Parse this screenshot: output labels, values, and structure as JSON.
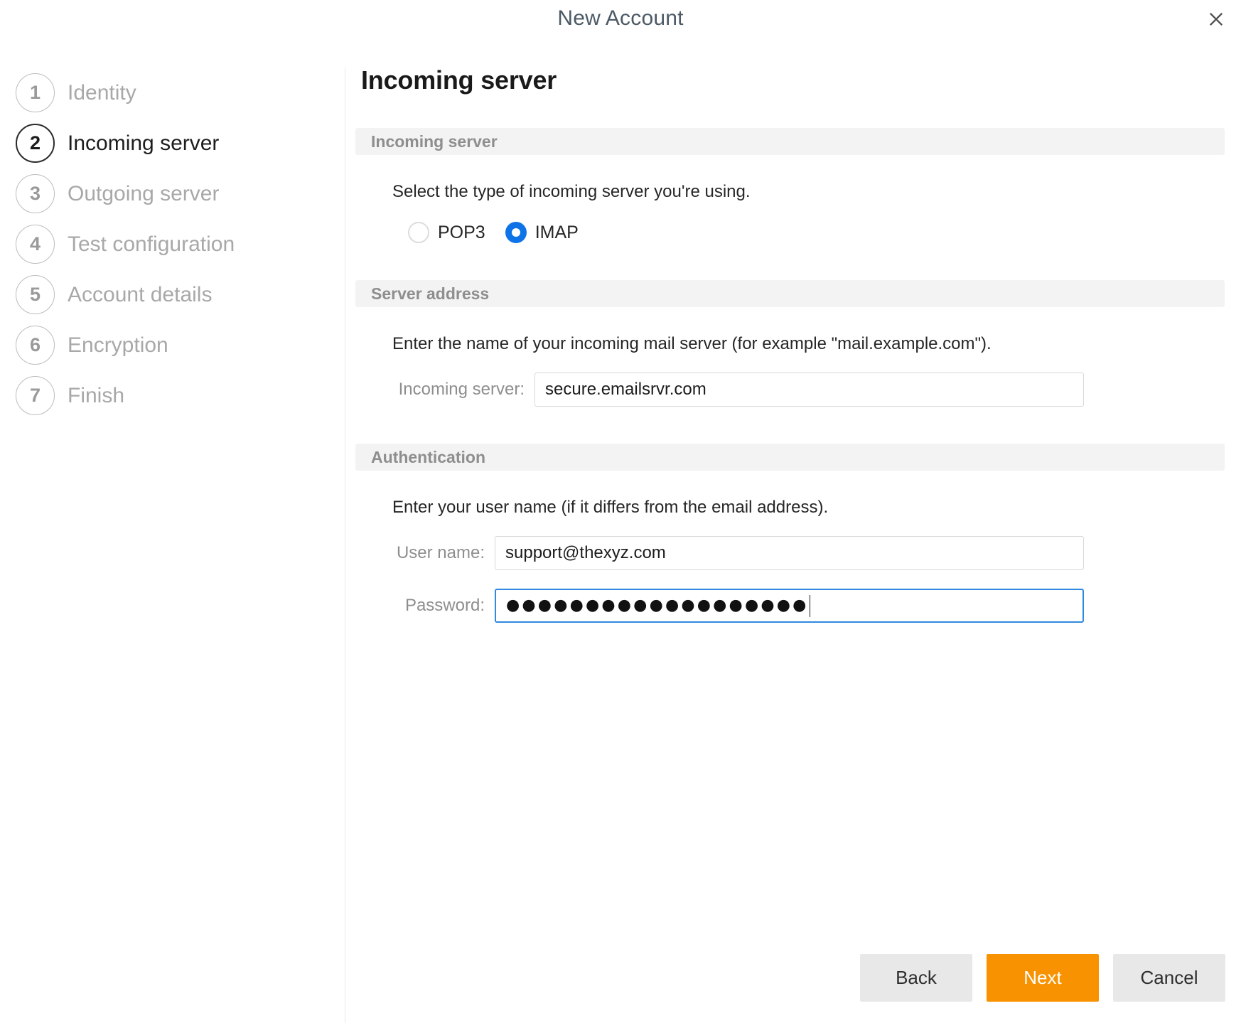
{
  "window": {
    "title": "New Account",
    "close_icon": "close-icon"
  },
  "sidebar": {
    "steps": [
      {
        "number": "1",
        "label": "Identity",
        "active": false
      },
      {
        "number": "2",
        "label": "Incoming server",
        "active": true
      },
      {
        "number": "3",
        "label": "Outgoing server",
        "active": false
      },
      {
        "number": "4",
        "label": "Test configuration",
        "active": false
      },
      {
        "number": "5",
        "label": "Account details",
        "active": false
      },
      {
        "number": "6",
        "label": "Encryption",
        "active": false
      },
      {
        "number": "7",
        "label": "Finish",
        "active": false
      }
    ]
  },
  "main": {
    "page_title": "Incoming server",
    "sections": {
      "incoming_server": {
        "header": "Incoming server",
        "help": "Select the type of incoming server you're using.",
        "options": [
          {
            "label": "POP3",
            "selected": false
          },
          {
            "label": "IMAP",
            "selected": true
          }
        ]
      },
      "server_address": {
        "header": "Server address",
        "help": "Enter the name of your incoming mail server (for example \"mail.example.com\").",
        "field_label": "Incoming server:",
        "field_value": "secure.emailsrvr.com",
        "field_placeholder": ""
      },
      "authentication": {
        "header": "Authentication",
        "help": "Enter your user name (if it differs from the email address).",
        "username_label": "User name:",
        "username_value": "support@thexyz.com",
        "username_placeholder": "",
        "password_label": "Password:",
        "password_masked": "●●●●●●●●●●●●●●●●●●●",
        "password_placeholder": "",
        "password_focused": true
      }
    }
  },
  "footer": {
    "back_label": "Back",
    "next_label": "Next",
    "cancel_label": "Cancel"
  },
  "colors": {
    "accent_orange": "#f99200",
    "accent_blue": "#0f73e8",
    "focus_blue": "#2f8ae0",
    "section_bar": "#f3f3f3",
    "muted_text": "#a8a8a8"
  }
}
